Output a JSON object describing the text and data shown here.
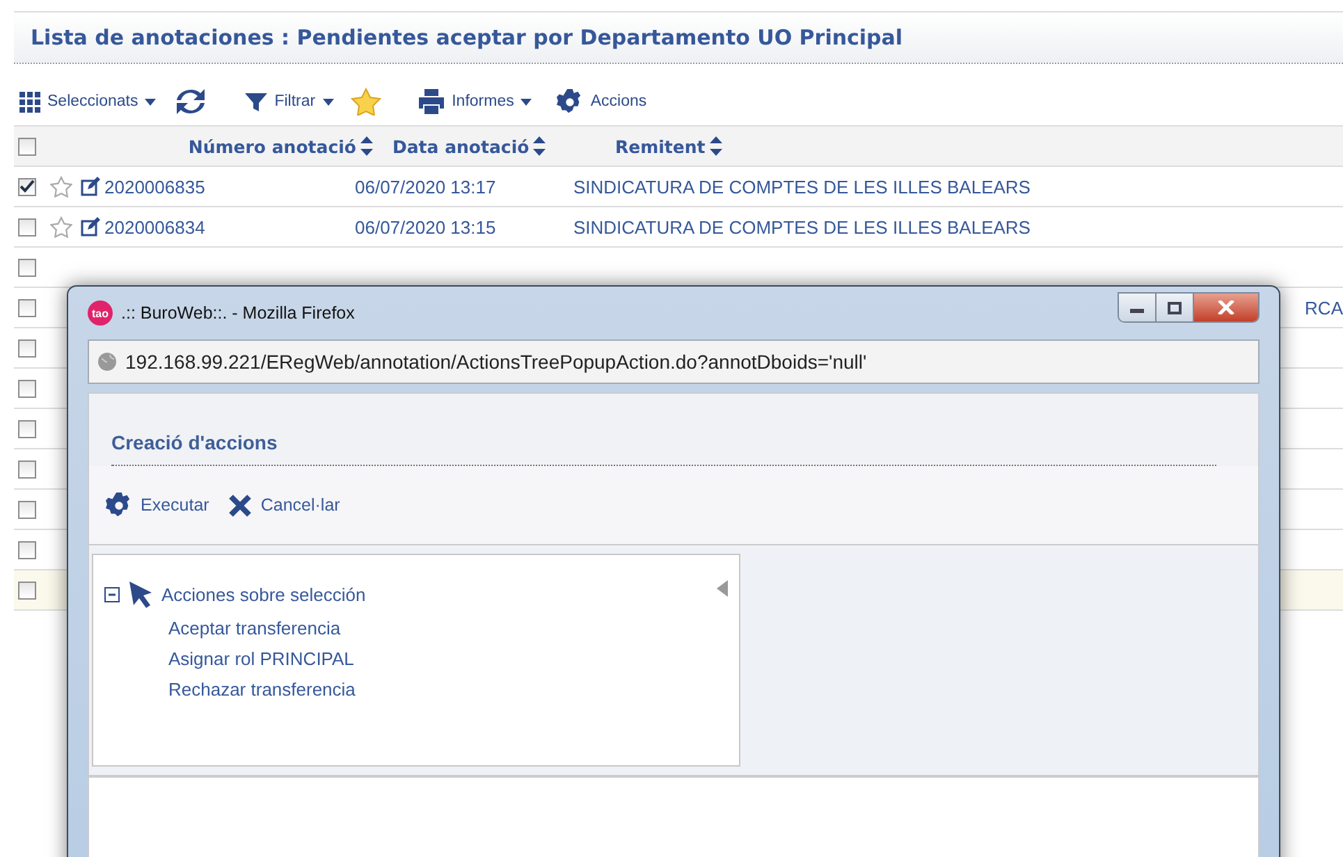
{
  "page_title": "Lista de anotaciones : Pendientes aceptar por Departamento UO Principal",
  "toolbar": [
    {
      "kind": "grid",
      "label": "Seleccionats",
      "dropdown": true
    },
    {
      "kind": "refresh"
    },
    {
      "kind": "filter",
      "label": "Filtrar",
      "dropdown": true
    },
    {
      "kind": "star"
    },
    {
      "kind": "print",
      "label": "Informes",
      "dropdown": true
    },
    {
      "kind": "gear",
      "label": "Accions",
      "dropdown": false
    }
  ],
  "table": {
    "header_checked": false,
    "columns": [
      "Número anotació",
      "Data anotació",
      "Remitent"
    ],
    "rows": [
      {
        "checked": true,
        "number": "2020006835",
        "date": "06/07/2020 13:17",
        "remitent": "SINDICATURA DE COMPTES DE LES ILLES BALEARS"
      },
      {
        "checked": false,
        "number": "2020006834",
        "date": "06/07/2020 13:15",
        "remitent": "SINDICATURA DE COMPTES DE LES ILLES BALEARS"
      },
      {
        "checked": false
      },
      {
        "checked": false,
        "remitent_tail": "RCA"
      },
      {
        "checked": false
      },
      {
        "checked": false
      },
      {
        "checked": false
      },
      {
        "checked": false
      },
      {
        "checked": false
      },
      {
        "checked": false
      },
      {
        "checked": false
      }
    ]
  },
  "popup": {
    "logo": "tao",
    "title": ".:: BuroWeb::. - Mozilla Firefox",
    "url": "192.168.99.221/ERegWeb/annotation/ActionsTreePopupAction.do?annotDboids='null'",
    "heading": "Creació d'accions",
    "actions": [
      {
        "kind": "gear",
        "label": "Executar"
      },
      {
        "kind": "cross",
        "label": "Cancel·lar"
      }
    ],
    "tree": {
      "label": "Acciones sobre selección",
      "expanded": true,
      "children": [
        {
          "label": "Aceptar transferencia"
        },
        {
          "label": "Asignar rol PRINCIPAL"
        },
        {
          "label": "Rechazar transferencia"
        }
      ]
    }
  }
}
